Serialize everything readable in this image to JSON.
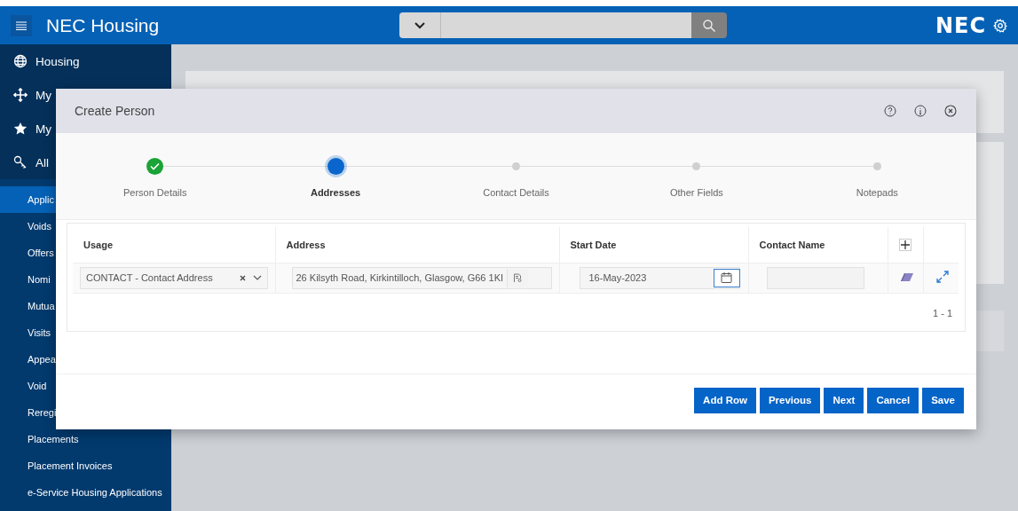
{
  "header": {
    "app_title": "NEC Housing",
    "logo": "NEC"
  },
  "sidebar": {
    "items": [
      {
        "label": "Housing",
        "kind": "globe"
      },
      {
        "label": "My",
        "kind": "move"
      },
      {
        "label": "My",
        "kind": "star"
      },
      {
        "label": "All",
        "kind": "key"
      }
    ],
    "sub_items": [
      {
        "label": "Applic",
        "selected": true
      },
      {
        "label": "Voids",
        "selected": false
      },
      {
        "label": "Offers",
        "selected": false
      },
      {
        "label": "Nomi",
        "selected": false
      },
      {
        "label": "Mutua",
        "selected": false
      },
      {
        "label": "Visits",
        "selected": false
      },
      {
        "label": "Appea",
        "selected": false
      },
      {
        "label": "Void",
        "selected": false
      },
      {
        "label": "Reregi",
        "selected": false
      },
      {
        "label": "Placements",
        "selected": false
      },
      {
        "label": "Placement Invoices",
        "selected": false
      },
      {
        "label": "e-Service Housing Applications",
        "selected": false
      }
    ]
  },
  "dialog": {
    "title": "Create Person",
    "steps": [
      {
        "label": "Person Details",
        "completed": true,
        "selected": false
      },
      {
        "label": "Addresses",
        "completed": false,
        "selected": true
      },
      {
        "label": "Contact Details",
        "completed": false,
        "selected": false
      },
      {
        "label": "Other Fields",
        "completed": false,
        "selected": false
      },
      {
        "label": "Notepads",
        "completed": false,
        "selected": false
      }
    ],
    "table": {
      "columns": [
        "Usage",
        "Address",
        "Start Date",
        "Contact Name"
      ],
      "rows": [
        {
          "usage": "CONTACT - Contact Address",
          "address": "26 Kilsyth Road, Kirkintilloch, Glasgow, G66 1KI",
          "start_date": "16-May-2023"
        }
      ],
      "pagination": "1 - 1"
    },
    "buttons": [
      "Add Row",
      "Previous",
      "Next",
      "Cancel",
      "Save"
    ]
  }
}
